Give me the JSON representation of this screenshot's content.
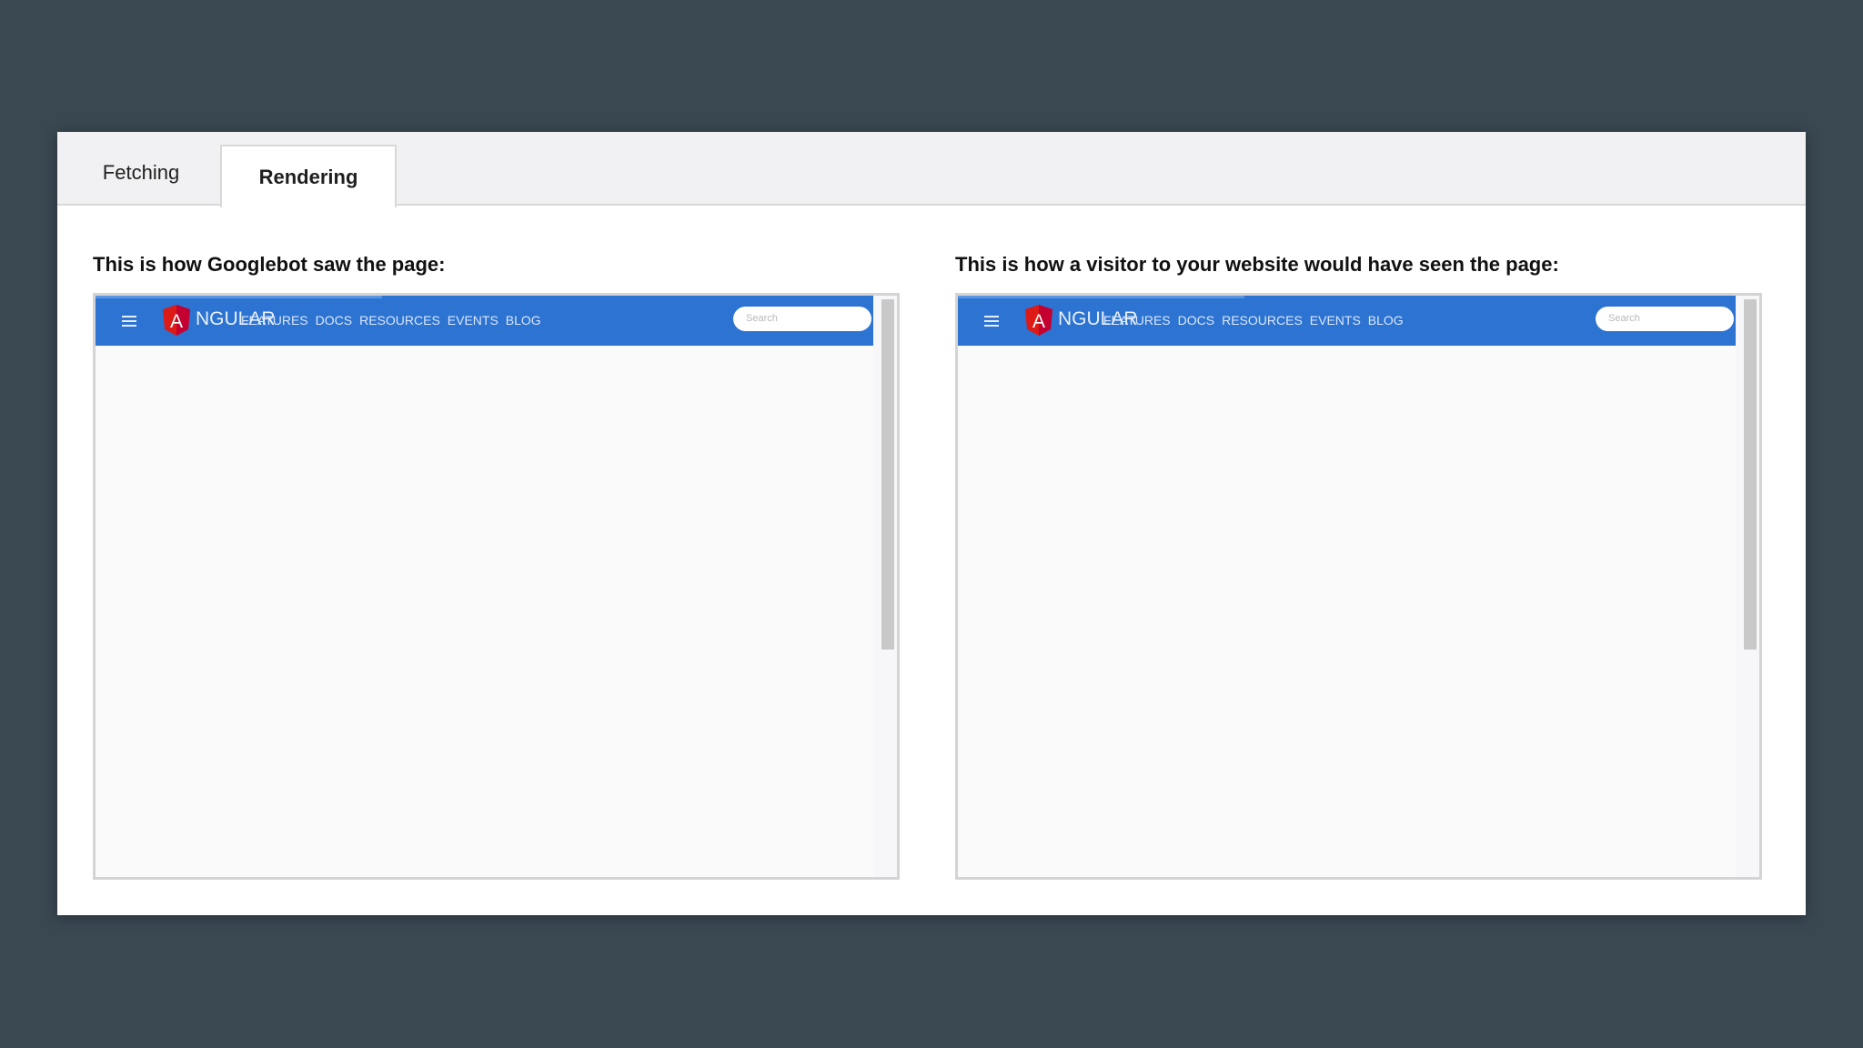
{
  "tabs": [
    {
      "label": "Fetching",
      "active": false
    },
    {
      "label": "Rendering",
      "active": true
    }
  ],
  "panels": [
    {
      "title": "This is how Googlebot saw the page:",
      "preview": {
        "logo_text": "NGULAR",
        "nav_links": [
          "FEATURES",
          "DOCS",
          "RESOURCES",
          "EVENTS",
          "BLOG"
        ],
        "search_placeholder": "Search"
      }
    },
    {
      "title": "This is how a visitor to your website would have seen the page:",
      "preview": {
        "logo_text": "NGULAR",
        "nav_links": [
          "FEATURES",
          "DOCS",
          "RESOURCES",
          "EVENTS",
          "BLOG"
        ],
        "search_placeholder": "Search"
      }
    }
  ],
  "colors": {
    "navbar": "#2c73d2",
    "logo_red": "#dd1b16",
    "page_background": "#3a4852"
  },
  "icons": {
    "menu": "hamburger-menu-icon",
    "logo": "angular-logo-icon"
  }
}
